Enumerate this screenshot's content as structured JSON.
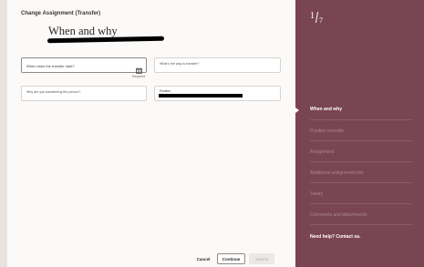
{
  "page": {
    "title": "Change Assignment (Transfer)"
  },
  "section": {
    "title": "When and why"
  },
  "fields": {
    "when": {
      "label": "When does the transfer start?",
      "required_note": "Required"
    },
    "way": {
      "label": "What's the way to transfer?"
    },
    "why": {
      "label": "Why are you transferring the person?"
    },
    "position": {
      "label": "Position"
    }
  },
  "footer": {
    "cancel": "Cancel",
    "continue": "Continue",
    "submit": "Submit"
  },
  "guide": {
    "step_current": "1",
    "step_total": "7",
    "steps": [
      "When and why",
      "Position override",
      "Assignment",
      "Additional assignment info",
      "Salary",
      "Comments and attachments"
    ],
    "active_step": "When and why",
    "help": "Need help? Contact us."
  },
  "colors": {
    "guide_background": "#7a4552",
    "active_text": "#ffffff",
    "inactive_text": "#a98792"
  },
  "icons": {
    "calendar": "calendar-icon"
  }
}
